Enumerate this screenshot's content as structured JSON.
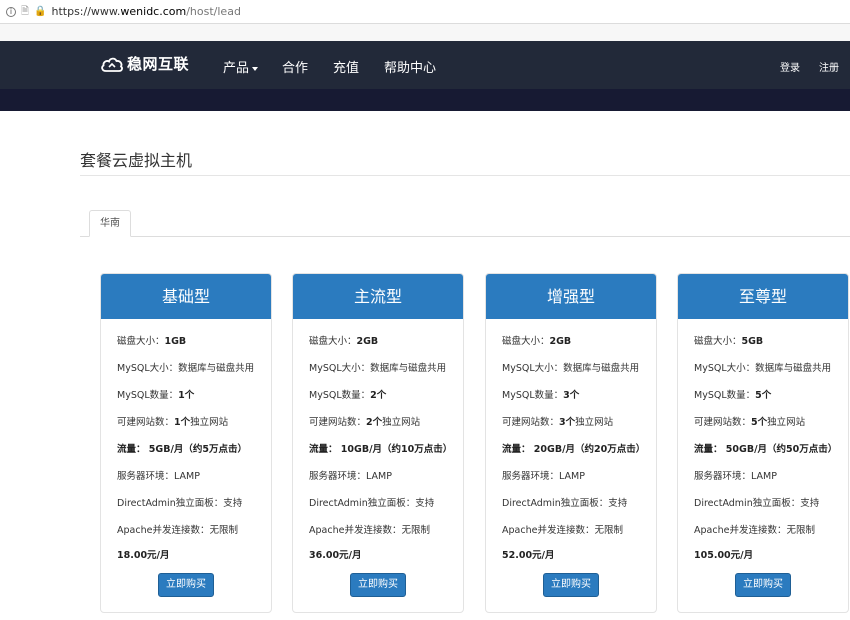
{
  "browser": {
    "url_scheme": "https://www.",
    "url_domain": "wenidc.com",
    "url_path": "/host/lead"
  },
  "nav": {
    "logo": "稳网互联",
    "items": [
      {
        "label": "产品",
        "dropdown": true
      },
      {
        "label": "合作"
      },
      {
        "label": "充值"
      },
      {
        "label": "帮助中心"
      }
    ],
    "login": "登录",
    "register": "注册"
  },
  "page": {
    "title": "套餐云虚拟主机",
    "tab": "华南"
  },
  "plans": [
    {
      "name": "基础型",
      "disk_label": "磁盘大小：",
      "disk": "1GB",
      "mysql_size": "MySQL大小：数据库与磁盘共用",
      "mysql_count_label": "MySQL数量：",
      "mysql_count": "1个",
      "sites_label": "可建网站数：",
      "sites": "1个",
      "sites_suffix": "独立网站",
      "traffic": "流量：  5GB/月（约5万点击）",
      "env": "服务器环境：LAMP",
      "panel": "DirectAdmin独立面板：支持",
      "apache": "Apache并发连接数：无限制",
      "price": "18.00元/月",
      "buy": "立即购买"
    },
    {
      "name": "主流型",
      "disk_label": "磁盘大小：",
      "disk": "2GB",
      "mysql_size": "MySQL大小：数据库与磁盘共用",
      "mysql_count_label": "MySQL数量：",
      "mysql_count": "2个",
      "sites_label": "可建网站数：",
      "sites": "2个",
      "sites_suffix": "独立网站",
      "traffic": "流量：  10GB/月（约10万点击）",
      "env": "服务器环境：LAMP",
      "panel": "DirectAdmin独立面板：支持",
      "apache": "Apache并发连接数：无限制",
      "price": "36.00元/月",
      "buy": "立即购买"
    },
    {
      "name": "增强型",
      "disk_label": "磁盘大小：",
      "disk": "2GB",
      "mysql_size": "MySQL大小：数据库与磁盘共用",
      "mysql_count_label": "MySQL数量：",
      "mysql_count": "3个",
      "sites_label": "可建网站数：",
      "sites": "3个",
      "sites_suffix": "独立网站",
      "traffic": "流量：  20GB/月（约20万点击）",
      "env": "服务器环境：LAMP",
      "panel": "DirectAdmin独立面板：支持",
      "apache": "Apache并发连接数：无限制",
      "price": "52.00元/月",
      "buy": "立即购买"
    },
    {
      "name": "至尊型",
      "disk_label": "磁盘大小：",
      "disk": "5GB",
      "mysql_size": "MySQL大小：数据库与磁盘共用",
      "mysql_count_label": "MySQL数量：",
      "mysql_count": "5个",
      "sites_label": "可建网站数：",
      "sites": "5个",
      "sites_suffix": "独立网站",
      "traffic": "流量：  50GB/月（约50万点击）",
      "env": "服务器环境：LAMP",
      "panel": "DirectAdmin独立面板：支持",
      "apache": "Apache并发连接数：无限制",
      "price": "105.00元/月",
      "buy": "立即购买"
    }
  ],
  "colors": {
    "nav_bg": "#222939",
    "banner": "#171a33",
    "accent": "#2b7bbf"
  },
  "icons": [
    "info-icon",
    "page-icon",
    "lock-icon",
    "cloud-logo-icon",
    "caret-down-icon"
  ]
}
